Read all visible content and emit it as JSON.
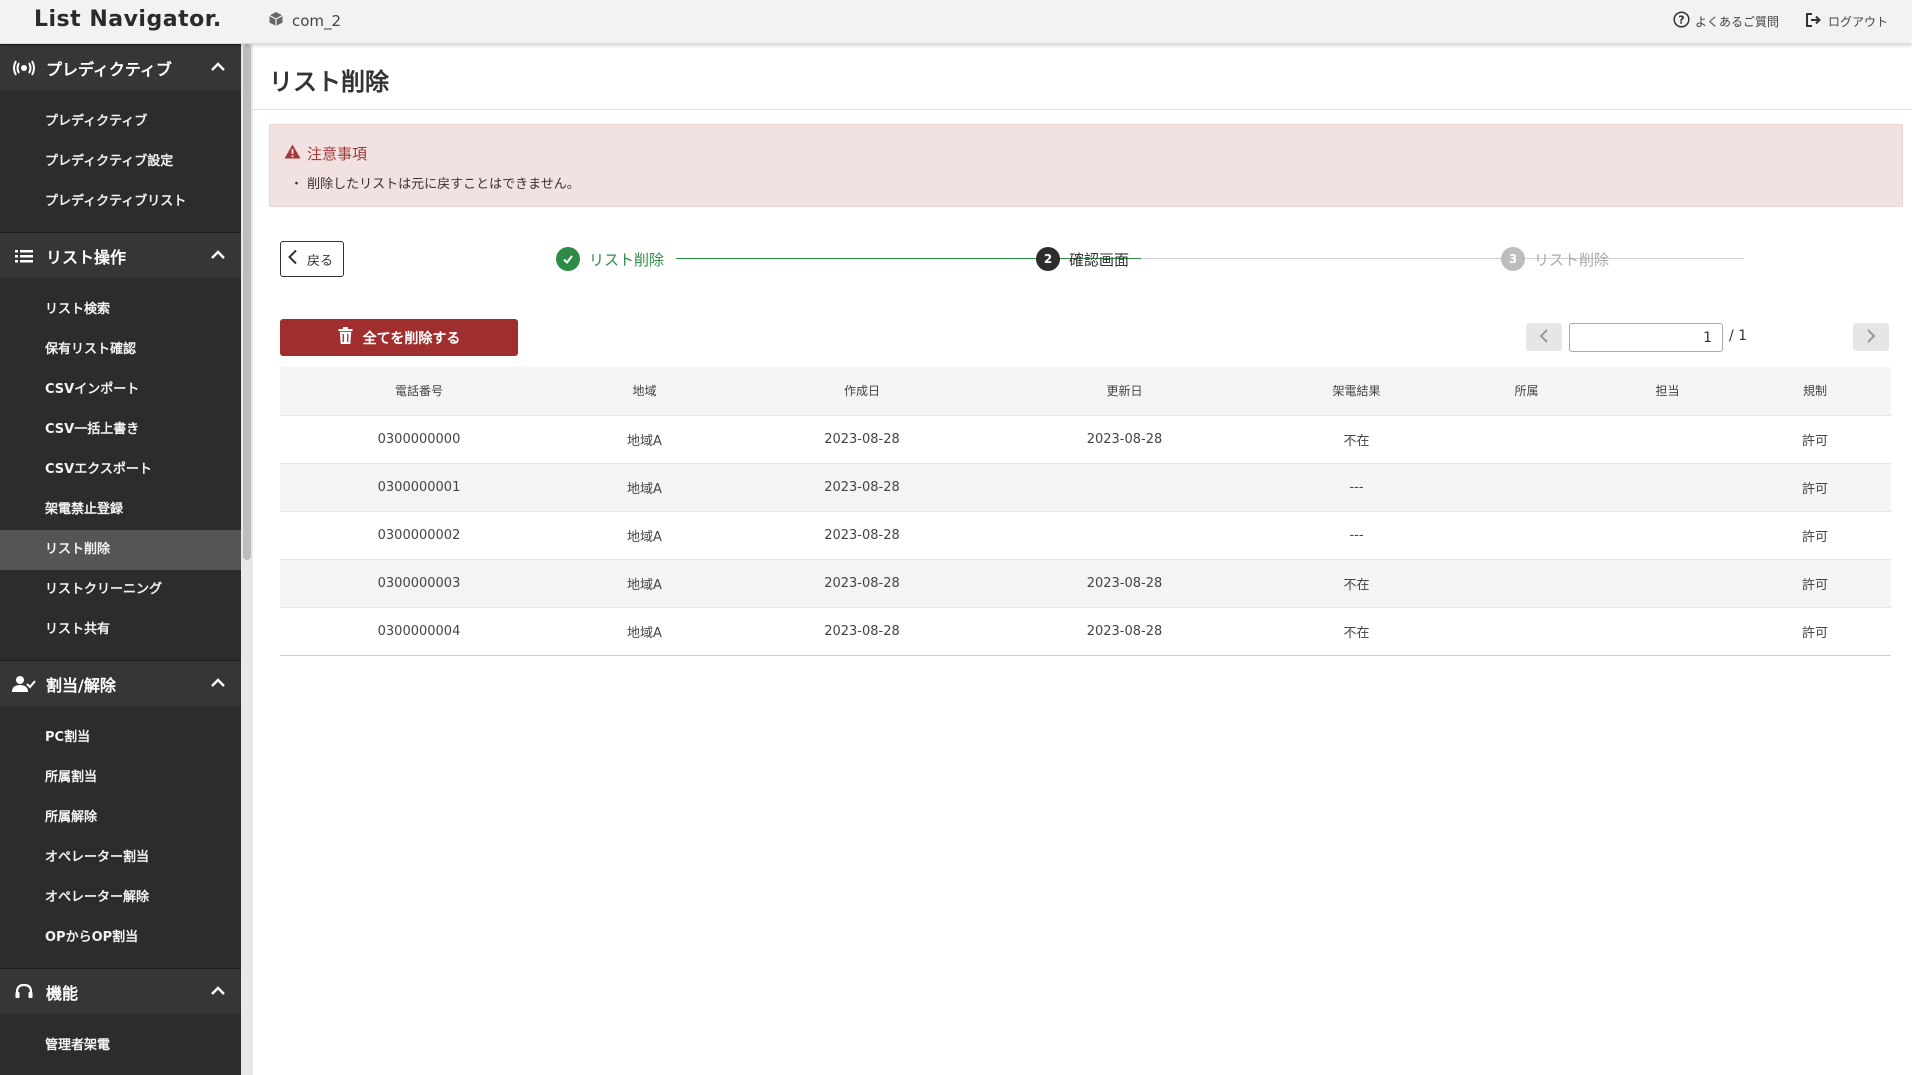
{
  "app": {
    "logo": "List Navigator.",
    "company": "com_2"
  },
  "top_links": {
    "faq": "よくあるご質問",
    "logout": "ログアウト"
  },
  "sidebar": {
    "sections": [
      {
        "title": "プレディクティブ",
        "icon": "predictive-icon",
        "items": [
          "プレディクティブ",
          "プレディクティブ設定",
          "プレディクティブリスト"
        ]
      },
      {
        "title": "リスト操作",
        "icon": "list-icon",
        "items": [
          "リスト検索",
          "保有リスト確認",
          "CSVインポート",
          "CSV一括上書き",
          "CSVエクスポート",
          "架電禁止登録",
          "リスト削除",
          "リストクリーニング",
          "リスト共有"
        ]
      },
      {
        "title": "割当/解除",
        "icon": "user-check-icon",
        "items": [
          "PC割当",
          "所属割当",
          "所属解除",
          "オペレーター割当",
          "オペレーター解除",
          "OPからOP割当"
        ]
      },
      {
        "title": "機能",
        "icon": "headset-icon",
        "items": [
          "管理者架電"
        ]
      }
    ],
    "active_item": "リスト削除"
  },
  "page": {
    "title": "リスト削除"
  },
  "alert": {
    "title": "注意事項",
    "text": "・ 削除したリストは元に戻すことはできません。"
  },
  "back_label": "戻る",
  "steps": [
    {
      "number": "✓",
      "label": "リスト削除",
      "state": "done"
    },
    {
      "number": "2",
      "label": "確認画面",
      "state": "current"
    },
    {
      "number": "3",
      "label": "リスト削除",
      "state": "pending"
    }
  ],
  "delete_all_label": "全てを削除する",
  "pagination": {
    "current": "1",
    "total": "/ 1"
  },
  "table": {
    "headers": [
      "電話番号",
      "地域",
      "作成日",
      "更新日",
      "架電結果",
      "所属",
      "担当",
      "規制"
    ],
    "rows": [
      [
        "0300000000",
        "地域A",
        "2023-08-28",
        "2023-08-28",
        "不在",
        "",
        "",
        "許可"
      ],
      [
        "0300000001",
        "地域A",
        "2023-08-28",
        "",
        "---",
        "",
        "",
        "許可"
      ],
      [
        "0300000002",
        "地域A",
        "2023-08-28",
        "",
        "---",
        "",
        "",
        "許可"
      ],
      [
        "0300000003",
        "地域A",
        "2023-08-28",
        "2023-08-28",
        "不在",
        "",
        "",
        "許可"
      ],
      [
        "0300000004",
        "地域A",
        "2023-08-28",
        "2023-08-28",
        "不在",
        "",
        "",
        "許可"
      ]
    ]
  },
  "colors": {
    "sidebar_bg": "#2c2c2c",
    "danger": "#a12e2e",
    "step_done": "#2e8b45",
    "alert_bg": "#f2e1e1"
  }
}
